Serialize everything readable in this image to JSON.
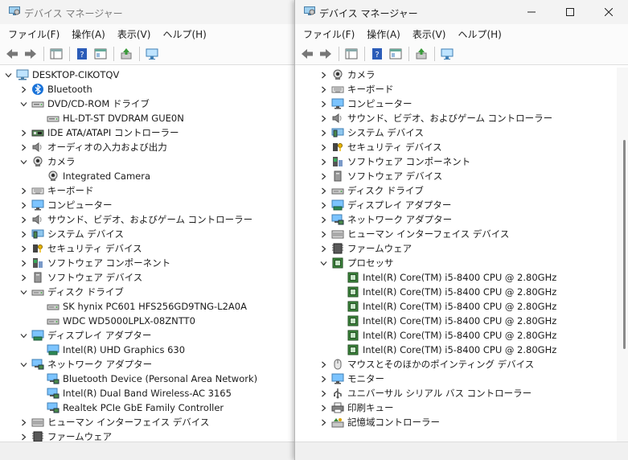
{
  "left_window": {
    "title": "デバイス マネージャー",
    "menu": [
      "ファイル(F)",
      "操作(A)",
      "表示(V)",
      "ヘルプ(H)"
    ],
    "tree": [
      {
        "label": "DESKTOP-CIKOTQV",
        "level": 0,
        "state": "expanded",
        "icon": "computer-icon"
      },
      {
        "label": "Bluetooth",
        "level": 1,
        "state": "collapsed",
        "icon": "bluetooth-icon"
      },
      {
        "label": "DVD/CD-ROM ドライブ",
        "level": 1,
        "state": "expanded",
        "icon": "dvd-drive-icon"
      },
      {
        "label": "HL-DT-ST DVDRAM GUE0N",
        "level": 2,
        "state": "leaf",
        "icon": "dvd-drive-icon"
      },
      {
        "label": "IDE ATA/ATAPI コントローラー",
        "level": 1,
        "state": "collapsed",
        "icon": "controller-icon"
      },
      {
        "label": "オーディオの入力および出力",
        "level": 1,
        "state": "collapsed",
        "icon": "speaker-icon"
      },
      {
        "label": "カメラ",
        "level": 1,
        "state": "expanded",
        "icon": "camera-icon"
      },
      {
        "label": "Integrated Camera",
        "level": 2,
        "state": "leaf",
        "icon": "camera-icon"
      },
      {
        "label": "キーボード",
        "level": 1,
        "state": "collapsed",
        "icon": "keyboard-icon"
      },
      {
        "label": "コンピューター",
        "level": 1,
        "state": "collapsed",
        "icon": "monitor-icon"
      },
      {
        "label": "サウンド、ビデオ、およびゲーム コントローラー",
        "level": 1,
        "state": "collapsed",
        "icon": "speaker-icon"
      },
      {
        "label": "システム デバイス",
        "level": 1,
        "state": "collapsed",
        "icon": "system-device-icon"
      },
      {
        "label": "セキュリティ デバイス",
        "level": 1,
        "state": "collapsed",
        "icon": "security-device-icon"
      },
      {
        "label": "ソフトウェア コンポーネント",
        "level": 1,
        "state": "collapsed",
        "icon": "software-component-icon"
      },
      {
        "label": "ソフトウェア デバイス",
        "level": 1,
        "state": "collapsed",
        "icon": "software-device-icon"
      },
      {
        "label": "ディスク ドライブ",
        "level": 1,
        "state": "expanded",
        "icon": "disk-drive-icon"
      },
      {
        "label": "SK hynix PC601 HFS256GD9TNG-L2A0A",
        "level": 2,
        "state": "leaf",
        "icon": "disk-drive-icon"
      },
      {
        "label": "WDC WD5000LPLX-08ZNTT0",
        "level": 2,
        "state": "leaf",
        "icon": "disk-drive-icon"
      },
      {
        "label": "ディスプレイ アダプター",
        "level": 1,
        "state": "expanded",
        "icon": "display-adapter-icon"
      },
      {
        "label": "Intel(R) UHD Graphics 630",
        "level": 2,
        "state": "leaf",
        "icon": "display-adapter-icon"
      },
      {
        "label": "ネットワーク アダプター",
        "level": 1,
        "state": "expanded",
        "icon": "network-adapter-icon"
      },
      {
        "label": "Bluetooth Device (Personal Area Network)",
        "level": 2,
        "state": "leaf",
        "icon": "network-adapter-icon"
      },
      {
        "label": "Intel(R) Dual Band Wireless-AC 3165",
        "level": 2,
        "state": "leaf",
        "icon": "network-adapter-icon"
      },
      {
        "label": "Realtek PCIe GbE Family Controller",
        "level": 2,
        "state": "leaf",
        "icon": "network-adapter-icon"
      },
      {
        "label": "ヒューマン インターフェイス デバイス",
        "level": 1,
        "state": "collapsed",
        "icon": "hid-icon"
      },
      {
        "label": "ファームウェア",
        "level": 1,
        "state": "collapsed",
        "icon": "firmware-icon"
      }
    ]
  },
  "right_window": {
    "title": "デバイス マネージャー",
    "menu": [
      "ファイル(F)",
      "操作(A)",
      "表示(V)",
      "ヘルプ(H)"
    ],
    "tree": [
      {
        "label": "カメラ",
        "level": 1,
        "state": "collapsed",
        "icon": "camera-icon"
      },
      {
        "label": "キーボード",
        "level": 1,
        "state": "collapsed",
        "icon": "keyboard-icon"
      },
      {
        "label": "コンピューター",
        "level": 1,
        "state": "collapsed",
        "icon": "monitor-icon"
      },
      {
        "label": "サウンド、ビデオ、およびゲーム コントローラー",
        "level": 1,
        "state": "collapsed",
        "icon": "speaker-icon"
      },
      {
        "label": "システム デバイス",
        "level": 1,
        "state": "collapsed",
        "icon": "system-device-icon"
      },
      {
        "label": "セキュリティ デバイス",
        "level": 1,
        "state": "collapsed",
        "icon": "security-device-icon"
      },
      {
        "label": "ソフトウェア コンポーネント",
        "level": 1,
        "state": "collapsed",
        "icon": "software-component-icon"
      },
      {
        "label": "ソフトウェア デバイス",
        "level": 1,
        "state": "collapsed",
        "icon": "software-device-icon"
      },
      {
        "label": "ディスク ドライブ",
        "level": 1,
        "state": "collapsed",
        "icon": "disk-drive-icon"
      },
      {
        "label": "ディスプレイ アダプター",
        "level": 1,
        "state": "collapsed",
        "icon": "display-adapter-icon"
      },
      {
        "label": "ネットワーク アダプター",
        "level": 1,
        "state": "collapsed",
        "icon": "network-adapter-icon"
      },
      {
        "label": "ヒューマン インターフェイス デバイス",
        "level": 1,
        "state": "collapsed",
        "icon": "hid-icon"
      },
      {
        "label": "ファームウェア",
        "level": 1,
        "state": "collapsed",
        "icon": "firmware-icon"
      },
      {
        "label": "プロセッサ",
        "level": 1,
        "state": "expanded",
        "icon": "processor-icon"
      },
      {
        "label": "Intel(R) Core(TM) i5-8400 CPU @ 2.80GHz",
        "level": 2,
        "state": "leaf",
        "icon": "processor-icon"
      },
      {
        "label": "Intel(R) Core(TM) i5-8400 CPU @ 2.80GHz",
        "level": 2,
        "state": "leaf",
        "icon": "processor-icon"
      },
      {
        "label": "Intel(R) Core(TM) i5-8400 CPU @ 2.80GHz",
        "level": 2,
        "state": "leaf",
        "icon": "processor-icon"
      },
      {
        "label": "Intel(R) Core(TM) i5-8400 CPU @ 2.80GHz",
        "level": 2,
        "state": "leaf",
        "icon": "processor-icon"
      },
      {
        "label": "Intel(R) Core(TM) i5-8400 CPU @ 2.80GHz",
        "level": 2,
        "state": "leaf",
        "icon": "processor-icon"
      },
      {
        "label": "Intel(R) Core(TM) i5-8400 CPU @ 2.80GHz",
        "level": 2,
        "state": "leaf",
        "icon": "processor-icon"
      },
      {
        "label": "マウスとそのほかのポインティング デバイス",
        "level": 1,
        "state": "collapsed",
        "icon": "mouse-icon"
      },
      {
        "label": "モニター",
        "level": 1,
        "state": "collapsed",
        "icon": "monitor-icon"
      },
      {
        "label": "ユニバーサル シリアル バス コントローラー",
        "level": 1,
        "state": "collapsed",
        "icon": "usb-icon"
      },
      {
        "label": "印刷キュー",
        "level": 1,
        "state": "collapsed",
        "icon": "printer-icon"
      },
      {
        "label": "記憶域コントローラー",
        "level": 1,
        "state": "collapsed",
        "icon": "storage-controller-icon"
      }
    ]
  }
}
